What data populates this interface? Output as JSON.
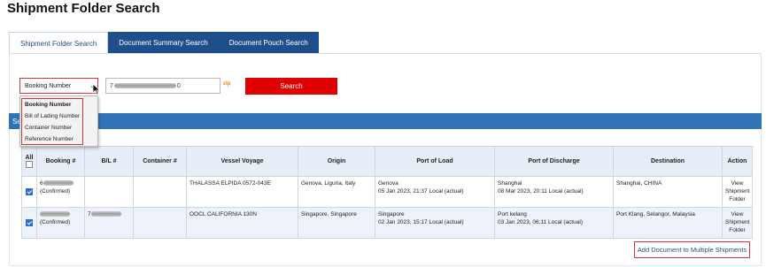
{
  "page": {
    "title": "Shipment Folder Search"
  },
  "tabs": [
    {
      "label": "Shipment Folder Search",
      "active": true
    },
    {
      "label": "Document Summary Search",
      "active": false
    },
    {
      "label": "Document Pouch Search",
      "active": false
    }
  ],
  "search": {
    "type_selected": "Booking Number",
    "type_options": [
      "Booking Number",
      "Bill of Lading Number",
      "Container Number",
      "Reference Number"
    ],
    "input_prefix": "7",
    "input_suffix": "0",
    "zip_icon": "zip",
    "button_label": "Search"
  },
  "results_bar": {
    "label": "Se"
  },
  "table": {
    "headers": {
      "all": "All",
      "booking": "Booking #",
      "bl": "B/L #",
      "container": "Container #",
      "vessel": "Vessel Voyage",
      "origin": "Origin",
      "port_load": "Port of Load",
      "port_discharge": "Port of Discharge",
      "destination": "Destination",
      "action": "Action"
    },
    "rows": [
      {
        "checked": true,
        "booking_prefix": "6",
        "booking_status": "(Confirmed)",
        "bl_prefix": "",
        "vessel": "THALASSA ELPIDA 0572-043E",
        "origin": "Genova, Liguria, Italy",
        "load_port": "Genova",
        "load_time": "05 Jan 2023, 21:37 Local (actual)",
        "discharge_port": "Shanghai",
        "discharge_time": "08 Mar 2023, 20:11 Local (actual)",
        "destination": "Shanghai, CHINA",
        "action": [
          "View",
          "Shipment",
          "Folder"
        ]
      },
      {
        "checked": true,
        "booking_prefix": "",
        "booking_status": "(Confirmed)",
        "bl_prefix": "7",
        "vessel": "OOCL CALIFORNIA 130N",
        "origin": "Singapore, Singapore",
        "load_port": "Singapore",
        "load_time": "02 Jan 2023, 15:17 Local (actual)",
        "discharge_port": "Port kelang",
        "discharge_time": "03 Jan 2023, 06:11 Local (actual)",
        "destination": "Port Klang, Selangor, Malaysia",
        "action": [
          "View",
          "Shipment",
          "Folder"
        ]
      }
    ]
  },
  "footer": {
    "add_document_label": "Add Document to Multiple Shipments"
  },
  "colors": {
    "nav_blue": "#1f4e8c",
    "search_red": "#e00000",
    "highlight_red": "#d9343e",
    "bar_blue": "#2f73b6"
  }
}
